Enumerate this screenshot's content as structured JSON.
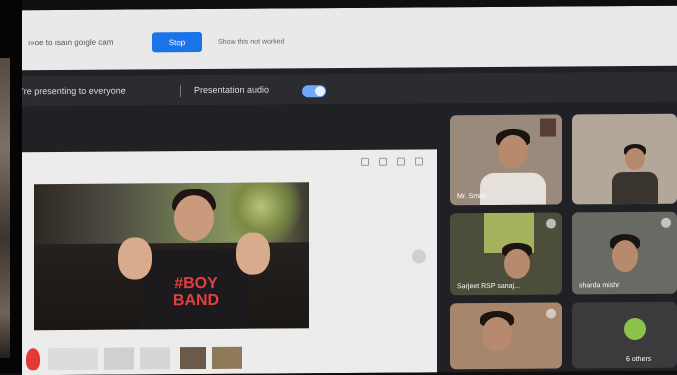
{
  "banner": {
    "message": "ı»oe to ısaın goıgle cam",
    "stop_label": "Stop",
    "dont_show_label": "Show this not worked"
  },
  "presentation_bar": {
    "presenting_text": "'re presenting to everyone",
    "audio_label": "Presentation audio",
    "audio_enabled": true
  },
  "slide": {
    "shirt_text": "#BOY BAND"
  },
  "participants": [
    {
      "name": "Mr. Smith",
      "tile": "top-left"
    },
    {
      "name": "",
      "tile": "top-right"
    },
    {
      "name": "Sarjeet RSP sanaj...",
      "tile": "middle-left"
    },
    {
      "name": "sharda mishr",
      "tile": "middle-right"
    },
    {
      "name": "",
      "tile": "bottom-left"
    },
    {
      "name": "6 others",
      "tile": "bottom-right"
    }
  ],
  "colors": {
    "accent_blue": "#1a73e8",
    "toggle_on": "#6ea8ff",
    "meet_bg": "#202124",
    "shirt_text_red": "#e14040"
  },
  "icons": [
    "toggle-switch",
    "mic-icon",
    "heart-icon"
  ]
}
